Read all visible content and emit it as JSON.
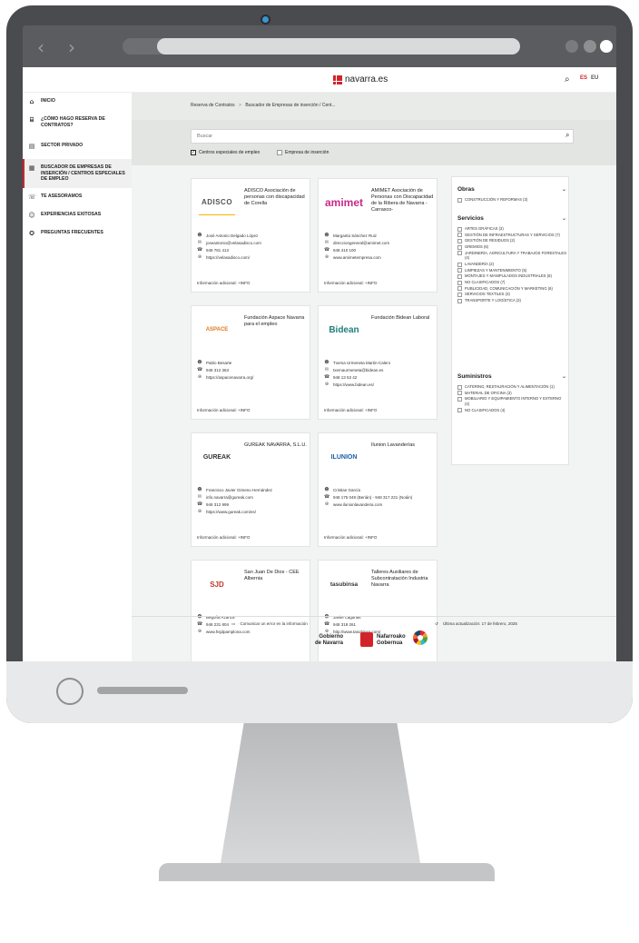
{
  "site": {
    "logo_text": "navarra.es",
    "lang_es": "ES",
    "lang_eu": "EU"
  },
  "sidebar": {
    "items": [
      {
        "label": "INICIO",
        "icon": "home-icon"
      },
      {
        "label": "¿CÓMO HAGO RESERVA DE CONTRATOS?",
        "icon": "institution-icon"
      },
      {
        "label": "SECTOR PRIVADO",
        "icon": "building-icon"
      },
      {
        "label": "BUSCADOR DE EMPRESAS DE INSERCIÓN / CENTROS ESPECIALES DE EMPLEO",
        "icon": "list-icon"
      },
      {
        "label": "TE ASESORAMOS",
        "icon": "advice-icon"
      },
      {
        "label": "EXPERIENCIAS EXITOSAS",
        "icon": "people-icon"
      },
      {
        "label": "PREGUNTAS FRECUENTES",
        "icon": "help-icon"
      }
    ]
  },
  "breadcrumb": {
    "root": "Reserva de Contratos",
    "separator": ">",
    "current": "Buscador de Empresas de inserción / Cent..."
  },
  "search": {
    "placeholder": "Buscar",
    "value": ""
  },
  "filters": {
    "cee": {
      "label": "Centros especiales de empleo",
      "checked": true
    },
    "ei": {
      "label": "Empresa de inserción",
      "checked": false
    }
  },
  "cards": [
    {
      "name": "ADISCO Asociación de personas con discapacidad de Corella",
      "logo": "ADISCO",
      "contact": "José Antonio Delgado López",
      "email": "joseantonio@velasadisco.com",
      "phone": "948 781 413",
      "web": "https://velasadisco.com/",
      "info": "Información adicional: +INFO"
    },
    {
      "name": "AMIMET Asociación de Personas con Discapacidad de la Ribera de Navarra - Carrasco-",
      "logo": "amimet",
      "contact": "Margarita Sánchez Ruiz",
      "email": "direcciongeneral@amimet.com",
      "phone": "948 410 100",
      "web": "www.amimetempresa.com",
      "info": "Información adicional: +INFO"
    },
    {
      "name": "Fundación Aspace Navarra para el empleo",
      "logo": "ASPACE",
      "contact": "Pablo Besarte",
      "phone": "948 312 363",
      "web": "https://aspacenavarra.org/",
      "info": "Información adicional: +INFO"
    },
    {
      "name": "Fundación Bidean Laboral",
      "logo": "Bidean",
      "contact": "Txema Urmeneta Martin-Calero",
      "email": "txemaurmeneta@bidean.es",
      "phone": "948 13 53 42",
      "web": "https://www.bidean.es/",
      "info": "Información adicional: +INFO"
    },
    {
      "name": "GUREAK NAVARRA, S.L.U.",
      "logo": "GUREAK",
      "contact": "Francisco Javier Gimeno Hernández",
      "email": "info.navarra@gureak.com",
      "phone": "948 312 999",
      "web": "https://www.gureak.com/es/",
      "info": "Información adicional: +INFO"
    },
    {
      "name": "Ilunion Lavanderías",
      "logo": "ILUNION",
      "contact": "Cristian García",
      "phone": "948 175 048 (Berián) - 948 317 221 (Noáin)",
      "web": "www.ilunionlavanderia.com",
      "info": "Información adicional: +INFO"
    },
    {
      "name": "San Juan De Dios - CEE Albernia",
      "logo": "SJD",
      "contact": "Begoña Azanza",
      "phone": "948 231 804",
      "web": "www.hsjdpamplona.com",
      "info": "Información adicional: +INFO"
    },
    {
      "name": "Talleres Auxiliares de Subcontratación Industria Navarra",
      "logo": "tasubinsa",
      "contact": "Javier Lagunas",
      "phone": "948 318 261",
      "web": "http://www.tasubinsa.com/",
      "info": "Información adicional: +INFO"
    }
  ],
  "panel": {
    "obras": {
      "title": "Obras",
      "options": [
        "CONSTRUCCIÓN Y REFORMAS (3)"
      ]
    },
    "servicios": {
      "title": "Servicios",
      "options": [
        "ARTES GRÁFICAS (3)",
        "GESTIÓN DE INFRAESTRUCTURAS Y SERVICIOS (7)",
        "GESTIÓN DE RESIDUOS (2)",
        "GREMIOS (6)",
        "JARDINERÍA, AGRICULTURA Y TRABAJOS FORESTALES (4)",
        "LAVANDERÍA (2)",
        "LIMPIEZAS Y MANTENIMIENTO (5)",
        "MONTAJES Y MANIPULADOS INDUSTRIALES (6)",
        "NO CLASIFICADOS (7)",
        "PUBLICIDAD, COMUNICACIÓN Y MARKETING (6)",
        "SERVICIOS TEXTILES (3)",
        "TRANSPORTE Y LOGÍSTICA (3)"
      ]
    },
    "suministros": {
      "title": "Suministros",
      "options": [
        "CATERING, RESTAURACIÓN Y ALIMENTACIÓN (1)",
        "MATERIAL DE OFICINA (3)",
        "MOBILIARIO Y EQUIPAMIENTO INTERNO Y EXTERNO (4)",
        "NO CLASIFICADOS (4)"
      ]
    }
  },
  "footer": {
    "report": "Comunicar un error en la información",
    "updated": "Última actualización: 17 de febrero, 2025",
    "gov_es_1": "Gobierno",
    "gov_es_2": "de Navarra",
    "gov_eu_1": "Nafarroako",
    "gov_eu_2": "Gobernua"
  },
  "colors": {
    "brand_red": "#d2232a",
    "band_gray": "#e2e5e1"
  }
}
